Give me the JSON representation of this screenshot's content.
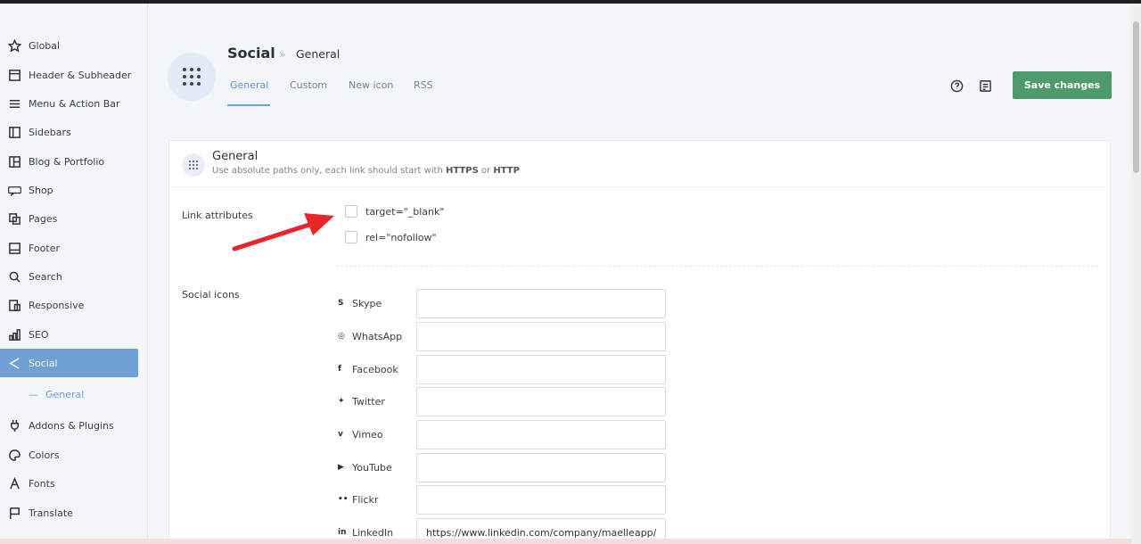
{
  "sidebar": {
    "items": [
      {
        "label": "Global",
        "icon": "star-icon"
      },
      {
        "label": "Header & Subheader",
        "icon": "header-icon"
      },
      {
        "label": "Menu & Action Bar",
        "icon": "menu-icon"
      },
      {
        "label": "Sidebars",
        "icon": "sidebar-icon"
      },
      {
        "label": "Blog & Portfolio",
        "icon": "layout-icon"
      },
      {
        "label": "Shop",
        "icon": "woo-icon"
      },
      {
        "label": "Pages",
        "icon": "pages-icon"
      },
      {
        "label": "Footer",
        "icon": "footer-icon"
      },
      {
        "label": "Search",
        "icon": "search-icon"
      },
      {
        "label": "Responsive",
        "icon": "responsive-icon"
      },
      {
        "label": "SEO",
        "icon": "seo-icon"
      },
      {
        "label": "Social",
        "icon": "share-icon"
      },
      {
        "label": "Addons & Plugins",
        "icon": "plug-icon"
      },
      {
        "label": "Colors",
        "icon": "palette-icon"
      },
      {
        "label": "Fonts",
        "icon": "font-icon"
      },
      {
        "label": "Translate",
        "icon": "flag-icon"
      }
    ],
    "sub_item": "General",
    "active": "Social"
  },
  "header": {
    "title": "Social",
    "separator": "»",
    "subtitle": "General",
    "tabs": [
      {
        "label": "General"
      },
      {
        "label": "Custom"
      },
      {
        "label": "New icon"
      },
      {
        "label": "RSS"
      }
    ],
    "save_label": "Save changes"
  },
  "panel": {
    "title": "General",
    "desc_prefix": "Use absolute paths only, each link should start with ",
    "desc_https": "HTTPS",
    "desc_or": " or ",
    "desc_http": "HTTP",
    "link_attributes_label": "Link attributes",
    "checkbox_target": "target=\"_blank\"",
    "checkbox_rel": "rel=\"nofollow\"",
    "social_icons_label": "Social icons",
    "socials": [
      {
        "name": "Skype",
        "glyph": "S",
        "value": ""
      },
      {
        "name": "WhatsApp",
        "glyph": "◎",
        "value": ""
      },
      {
        "name": "Facebook",
        "glyph": "f",
        "value": ""
      },
      {
        "name": "Twitter",
        "glyph": "✦",
        "value": ""
      },
      {
        "name": "Vimeo",
        "glyph": "v",
        "value": ""
      },
      {
        "name": "YouTube",
        "glyph": "▶",
        "value": ""
      },
      {
        "name": "Flickr",
        "glyph": "••",
        "value": ""
      },
      {
        "name": "LinkedIn",
        "glyph": "in",
        "value": "https://www.linkedin.com/company/maelleapp/"
      }
    ]
  },
  "colors": {
    "accent": "#6fa1d4",
    "save": "#4e9a6b",
    "arrow": "#e8262a"
  }
}
